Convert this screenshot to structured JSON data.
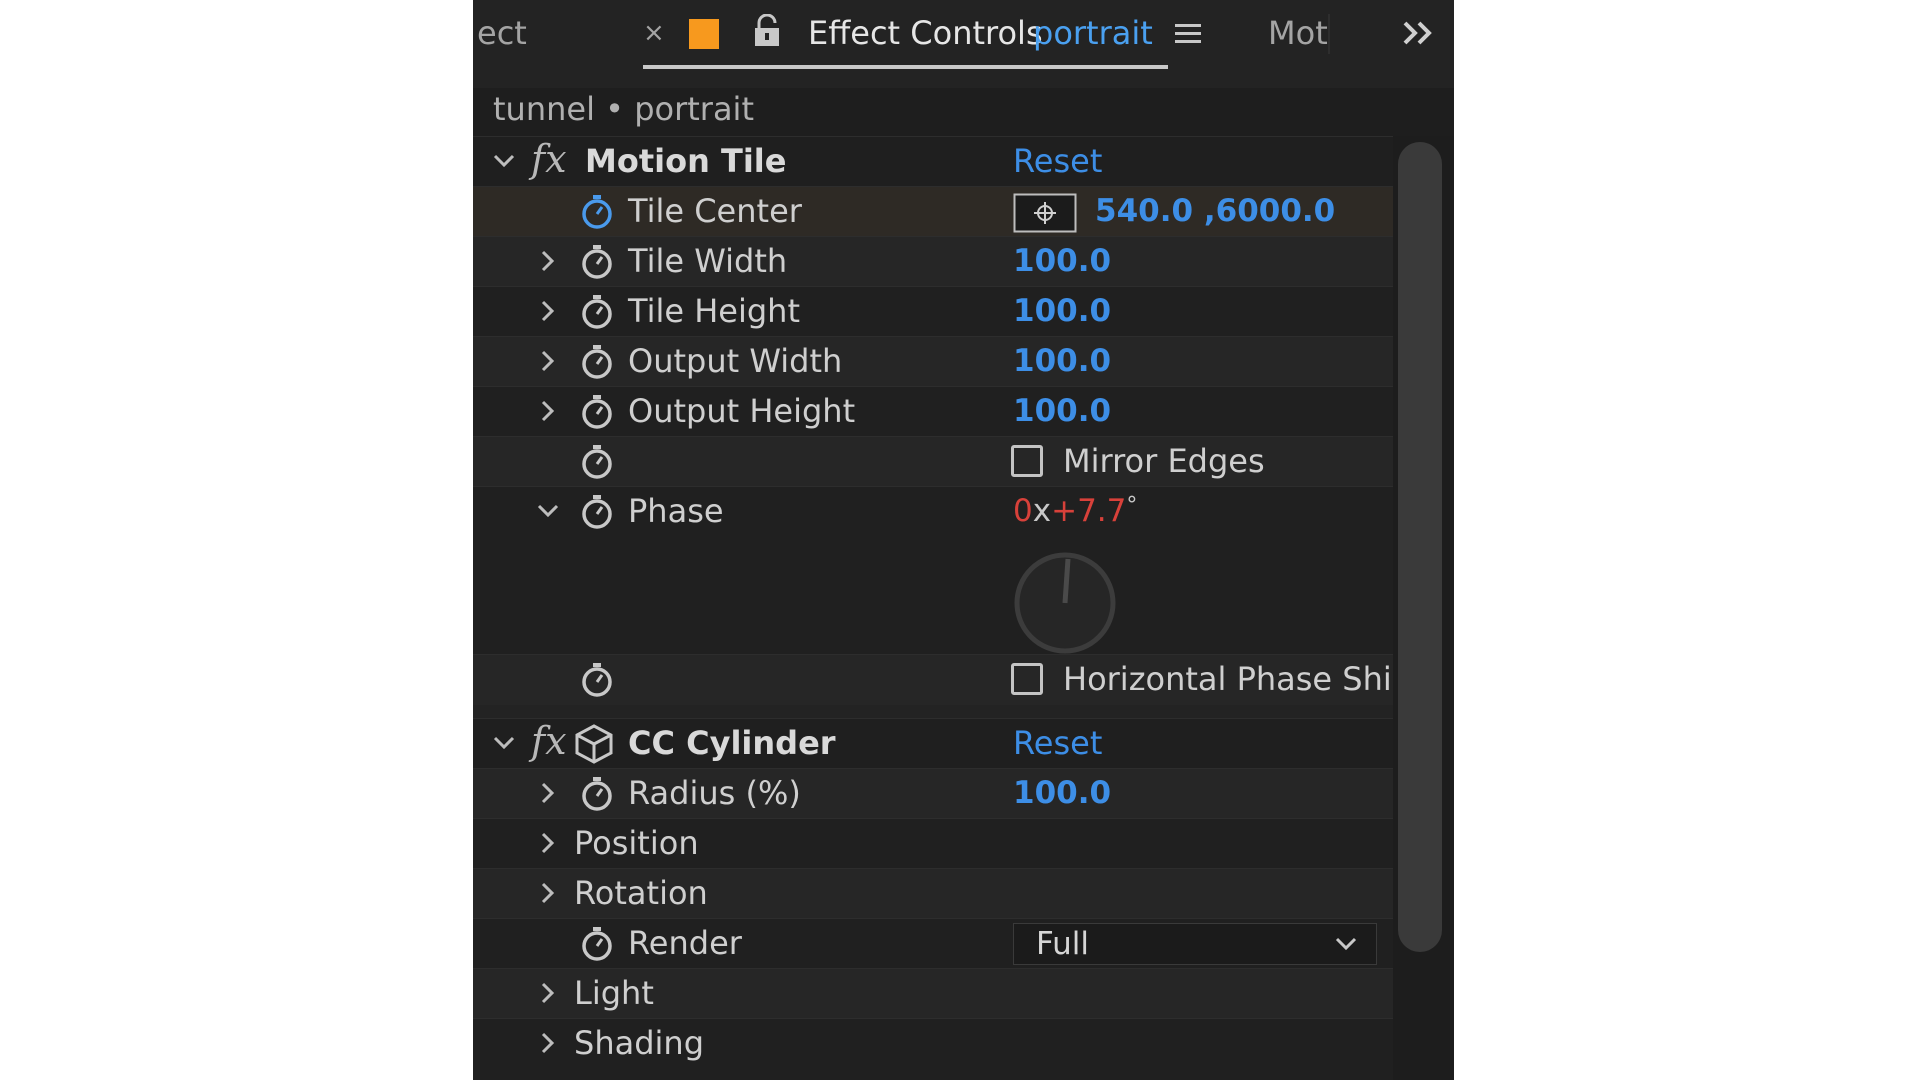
{
  "tabs": {
    "prev_tab_fragment": "ect",
    "close_glyph": "×",
    "title": "Effect Controls",
    "comp": "portrait",
    "next_tab_fragment": "Mot",
    "overflow_glyph": "»"
  },
  "breadcrumb": "tunnel • portrait",
  "effects": {
    "motion_tile": {
      "name": "Motion Tile",
      "reset": "Reset",
      "tile_center": {
        "label": "Tile Center",
        "value": "540.0 ,6000.0"
      },
      "tile_width": {
        "label": "Tile Width",
        "value": "100.0"
      },
      "tile_height": {
        "label": "Tile Height",
        "value": "100.0"
      },
      "output_width": {
        "label": "Output Width",
        "value": "100.0"
      },
      "output_height": {
        "label": "Output Height",
        "value": "100.0"
      },
      "mirror_edges": {
        "label": "Mirror Edges",
        "checked": false
      },
      "phase": {
        "label": "Phase",
        "revolutions": "0",
        "x": "x",
        "degrees": "+7.7",
        "unit": "°"
      },
      "horizontal_phase_shift": {
        "label": "Horizontal Phase Shi",
        "checked": false
      }
    },
    "cc_cylinder": {
      "name": "CC Cylinder",
      "reset": "Reset",
      "radius": {
        "label": "Radius (%)",
        "value": "100.0"
      },
      "position": {
        "label": "Position"
      },
      "rotation": {
        "label": "Rotation"
      },
      "render": {
        "label": "Render",
        "value": "Full"
      },
      "light": {
        "label": "Light"
      },
      "shading": {
        "label": "Shading"
      }
    }
  },
  "colors": {
    "panel_bg": "#232323",
    "value_blue": "#3d8ee6",
    "phase_red": "#d8413a",
    "orange": "#f7991e"
  },
  "icons": [
    "close-icon",
    "color-label-icon",
    "lock-icon",
    "panel-menu-icon",
    "overflow-chevrons-icon",
    "chevron-right-icon",
    "chevron-down-icon",
    "stopwatch-icon",
    "fx-icon",
    "crosshair-icon",
    "cube-icon",
    "dropdown-chevron-icon",
    "angle-dial-icon"
  ]
}
